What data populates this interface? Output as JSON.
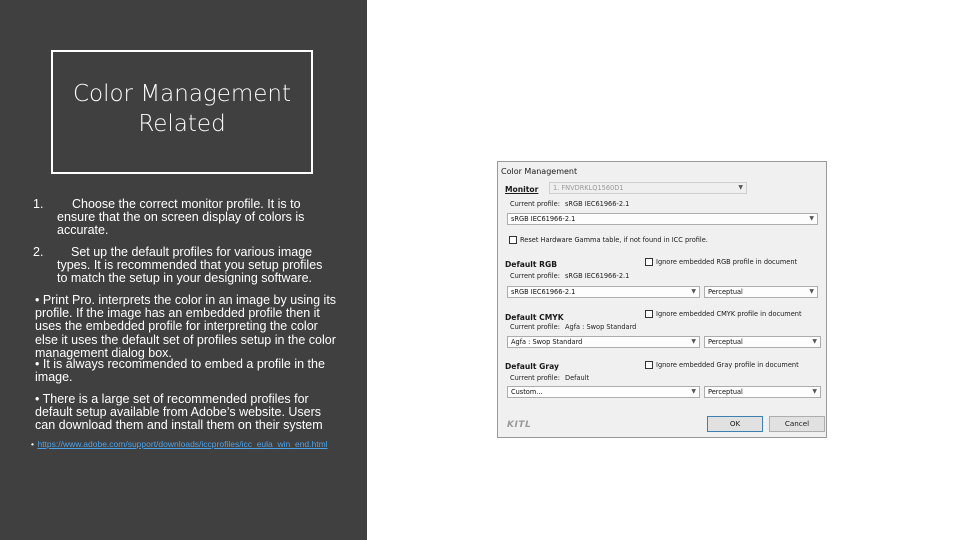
{
  "slide": {
    "title": "Color Management Related",
    "numbered": [
      {
        "num": "1.",
        "text": "Choose the correct monitor profile. It is to ensure that the on screen display of colors is accurate."
      },
      {
        "num": "2.",
        "text": "Set up the default profiles for various image types. It is recommended that you setup profiles to match the setup in your designing software."
      }
    ],
    "bullets": [
      "• Print Pro. interprets the color in an image by using its profile. If the image has an embedded profile then it uses the embedded profile for interpreting the color else it uses the default set of profiles setup in the color management dialog box.",
      "• It is always recommended to embed a profile in the image.",
      "• There is a large set of recommended profiles for default setup available from Adobe’s website. Users can download them and install them on their system"
    ],
    "link_bullet": "•",
    "link": "https://www.adobe.com/support/downloads/iccprofiles/icc_eula_win_end.html"
  },
  "dialog": {
    "title": "Color Management",
    "monitor": {
      "label": "Monitor",
      "select": "1. FNVDRKLQ1560D1",
      "current_label": "Current profile:",
      "current_value": "sRGB IEC61966-2.1",
      "profile": "sRGB IEC61966-2.1",
      "reset_label": "Reset Hardware Gamma table, if not found in ICC profile.",
      "reset_checked": false
    },
    "rgb": {
      "label": "Default RGB",
      "current_label": "Current profile:",
      "current_value": "sRGB IEC61966-2.1",
      "ignore_label": "Ignore embedded RGB profile in document",
      "profile": "sRGB IEC61966-2.1",
      "intent": "Perceptual"
    },
    "cmyk": {
      "label": "Default CMYK",
      "current_label": "Current profile:",
      "current_value": "Agfa : Swop Standard",
      "ignore_label": "Ignore embedded CMYK profile in document",
      "profile": "Agfa : Swop Standard",
      "intent": "Perceptual"
    },
    "gray": {
      "label": "Default Gray",
      "current_label": "Current profile:",
      "current_value": "Default",
      "ignore_label": "Ignore embedded Gray profile in document",
      "profile": "Custom...",
      "intent": "Perceptual"
    },
    "logo": "KITL",
    "ok": "OK",
    "cancel": "Cancel"
  },
  "colors": {
    "panel_bg": "#404040",
    "link": "#4ea1e6"
  }
}
